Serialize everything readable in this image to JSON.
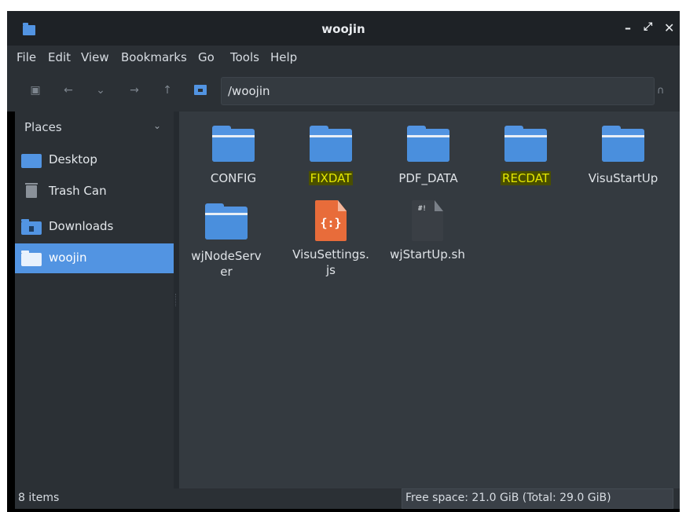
{
  "window": {
    "title": "woojin",
    "controls": {
      "minimize": "–",
      "maximize": "⤢",
      "close": "✕"
    }
  },
  "menu": [
    "File",
    "Edit",
    "View",
    "Bookmarks",
    "Go",
    "Tools",
    "Help"
  ],
  "toolbar": {
    "path": "/woojin",
    "buttons": [
      "computer-icon",
      "back-arrow-icon",
      "history-chevron-icon",
      "forward-arrow-icon",
      "up-arrow-icon"
    ]
  },
  "sidebar": {
    "header": "Places",
    "items": [
      {
        "label": "Desktop",
        "icon": "desktop-icon"
      },
      {
        "label": "Trash Can",
        "icon": "trash-icon"
      },
      {
        "label": "Downloads",
        "icon": "downloads-folder-icon"
      },
      {
        "label": "woojin",
        "icon": "home-folder-icon",
        "selected": true
      }
    ]
  },
  "files": [
    {
      "name": "CONFIG",
      "type": "folder",
      "highlighted": false
    },
    {
      "name": "FIXDAT",
      "type": "folder",
      "highlighted": true
    },
    {
      "name": "PDF_DATA",
      "type": "folder",
      "highlighted": false
    },
    {
      "name": "RECDAT",
      "type": "folder",
      "highlighted": true
    },
    {
      "name": "VisuStartUp",
      "type": "folder",
      "highlighted": false
    },
    {
      "name": "wjNodeServ\ner",
      "type": "folder",
      "highlighted": false
    },
    {
      "name": "VisuSettings.\njs",
      "type": "json",
      "glyph": "{:}"
    },
    {
      "name": "wjStartUp.sh",
      "type": "shell",
      "glyph": "#!"
    }
  ],
  "status": {
    "count": "8 items",
    "free_space": "Free space: 21.0 GiB (Total: 29.0 GiB)"
  },
  "colors": {
    "accent": "#5294e2",
    "highlight_bg": "#4a4f00",
    "highlight_text": "#e5e800",
    "json_file": "#e86c3a"
  }
}
